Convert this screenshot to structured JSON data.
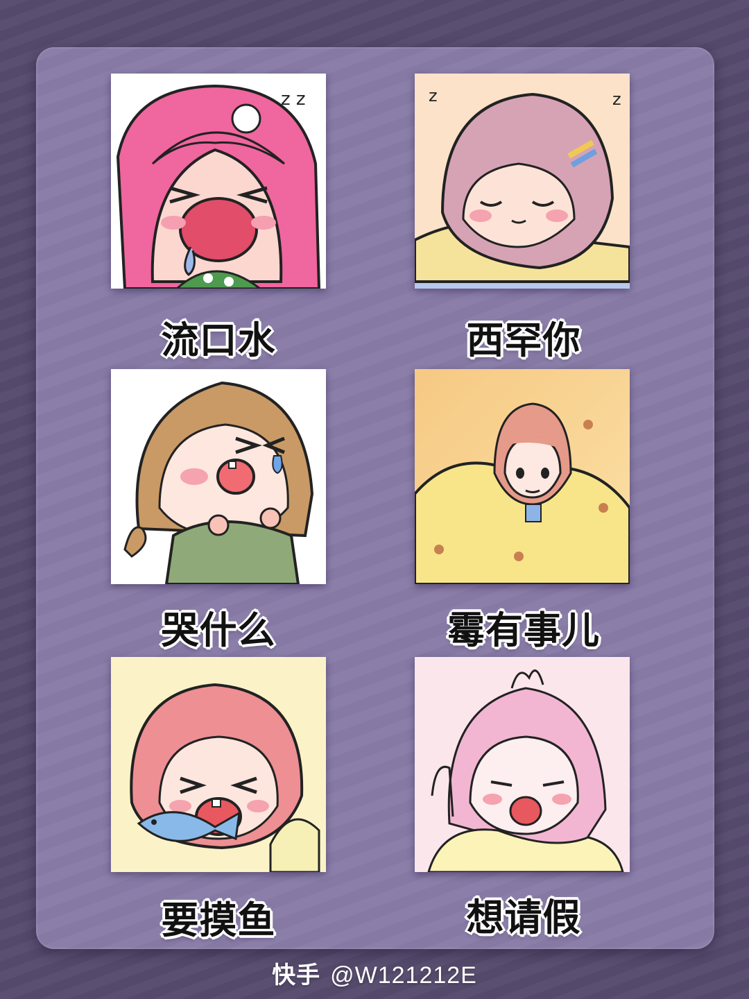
{
  "stickers": [
    {
      "caption": "流口水",
      "hair_color": "#f0669e",
      "bg_color": "#ffffff"
    },
    {
      "caption": "西罕你",
      "hair_color": "#d6a3b4",
      "bg_color": "#fbe2c9"
    },
    {
      "caption": "哭什么",
      "hair_color": "#c99a66",
      "bg_color": "#ffffff"
    },
    {
      "caption": "霉有事儿",
      "hair_color": "#e69a8a",
      "bg_color": "#f6d48f"
    },
    {
      "caption": "要摸鱼",
      "hair_color": "#ee8f93",
      "bg_color": "#fbf3c7"
    },
    {
      "caption": "想请假",
      "hair_color": "#f2b6d2",
      "bg_color": "#fbe6ec"
    }
  ],
  "footer": {
    "platform": "快手",
    "handle": "@W121212E"
  }
}
